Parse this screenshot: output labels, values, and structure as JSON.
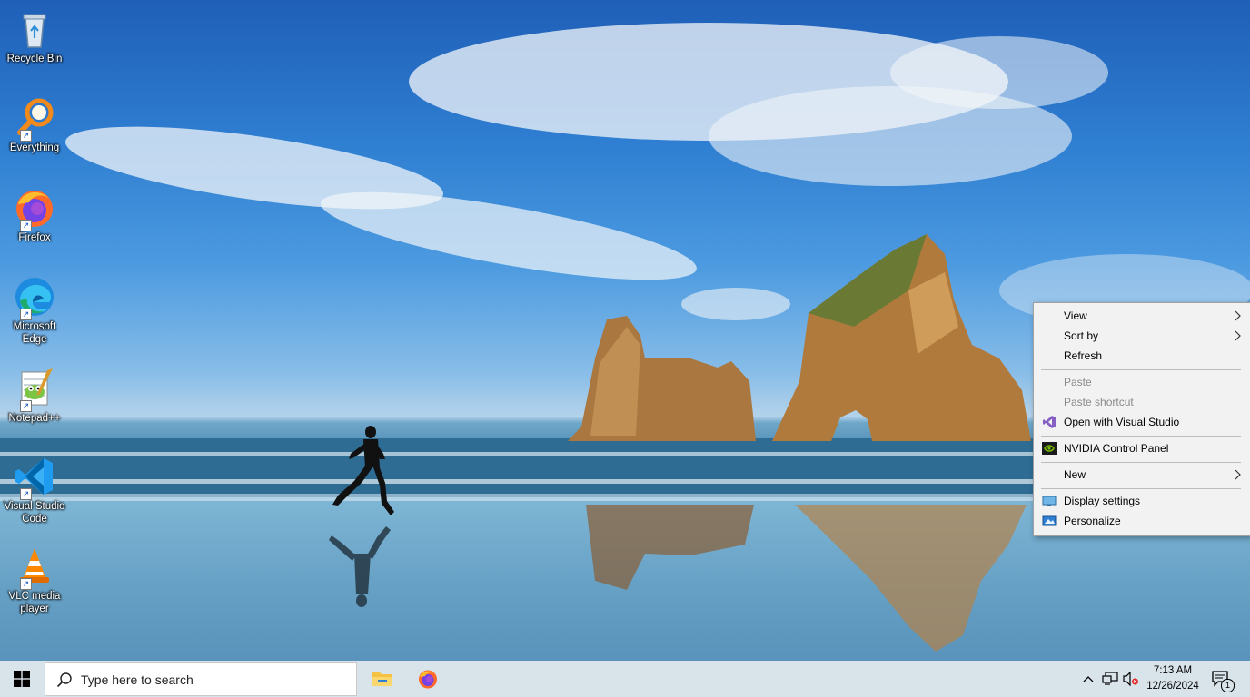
{
  "desktop": {
    "icons": [
      {
        "label": "Recycle Bin",
        "icon": "recycle-bin-icon"
      },
      {
        "label": "Everything",
        "icon": "everything-search-icon"
      },
      {
        "label": "Firefox",
        "icon": "firefox-icon"
      },
      {
        "label": "Microsoft Edge",
        "icon": "edge-icon"
      },
      {
        "label": "Notepad++",
        "icon": "notepad-plus-plus-icon"
      },
      {
        "label": "Visual Studio Code",
        "icon": "vscode-icon"
      },
      {
        "label": "VLC media player",
        "icon": "vlc-icon"
      }
    ]
  },
  "context_menu": {
    "items": [
      {
        "label": "View",
        "enabled": true,
        "submenu": true
      },
      {
        "label": "Sort by",
        "enabled": true,
        "submenu": true
      },
      {
        "label": "Refresh",
        "enabled": true
      },
      {
        "label": "Paste",
        "enabled": false
      },
      {
        "label": "Paste shortcut",
        "enabled": false
      },
      {
        "label": "Open with Visual Studio",
        "enabled": true,
        "icon": "visual-studio-icon"
      },
      {
        "label": "NVIDIA Control Panel",
        "enabled": true,
        "icon": "nvidia-icon"
      },
      {
        "label": "New",
        "enabled": true,
        "submenu": true
      },
      {
        "label": "Display settings",
        "enabled": true,
        "icon": "display-settings-icon"
      },
      {
        "label": "Personalize",
        "enabled": true,
        "icon": "personalize-icon"
      }
    ]
  },
  "taskbar": {
    "start_icon": "windows-logo-icon",
    "search_placeholder": "Type here to search",
    "pinned_apps": [
      {
        "name": "File Explorer",
        "icon": "file-explorer-icon"
      },
      {
        "name": "Firefox",
        "icon": "firefox-icon"
      }
    ],
    "tray": {
      "icons": [
        "chevron-up-icon",
        "network-icon",
        "volume-muted-icon"
      ],
      "time": "7:13 AM",
      "date": "12/26/2024",
      "notification_count": "1"
    }
  },
  "colors": {
    "taskbar_bg": "#d9e3ea",
    "menu_bg": "#f2f2f2",
    "menu_disabled_text": "#8a8a8a"
  }
}
